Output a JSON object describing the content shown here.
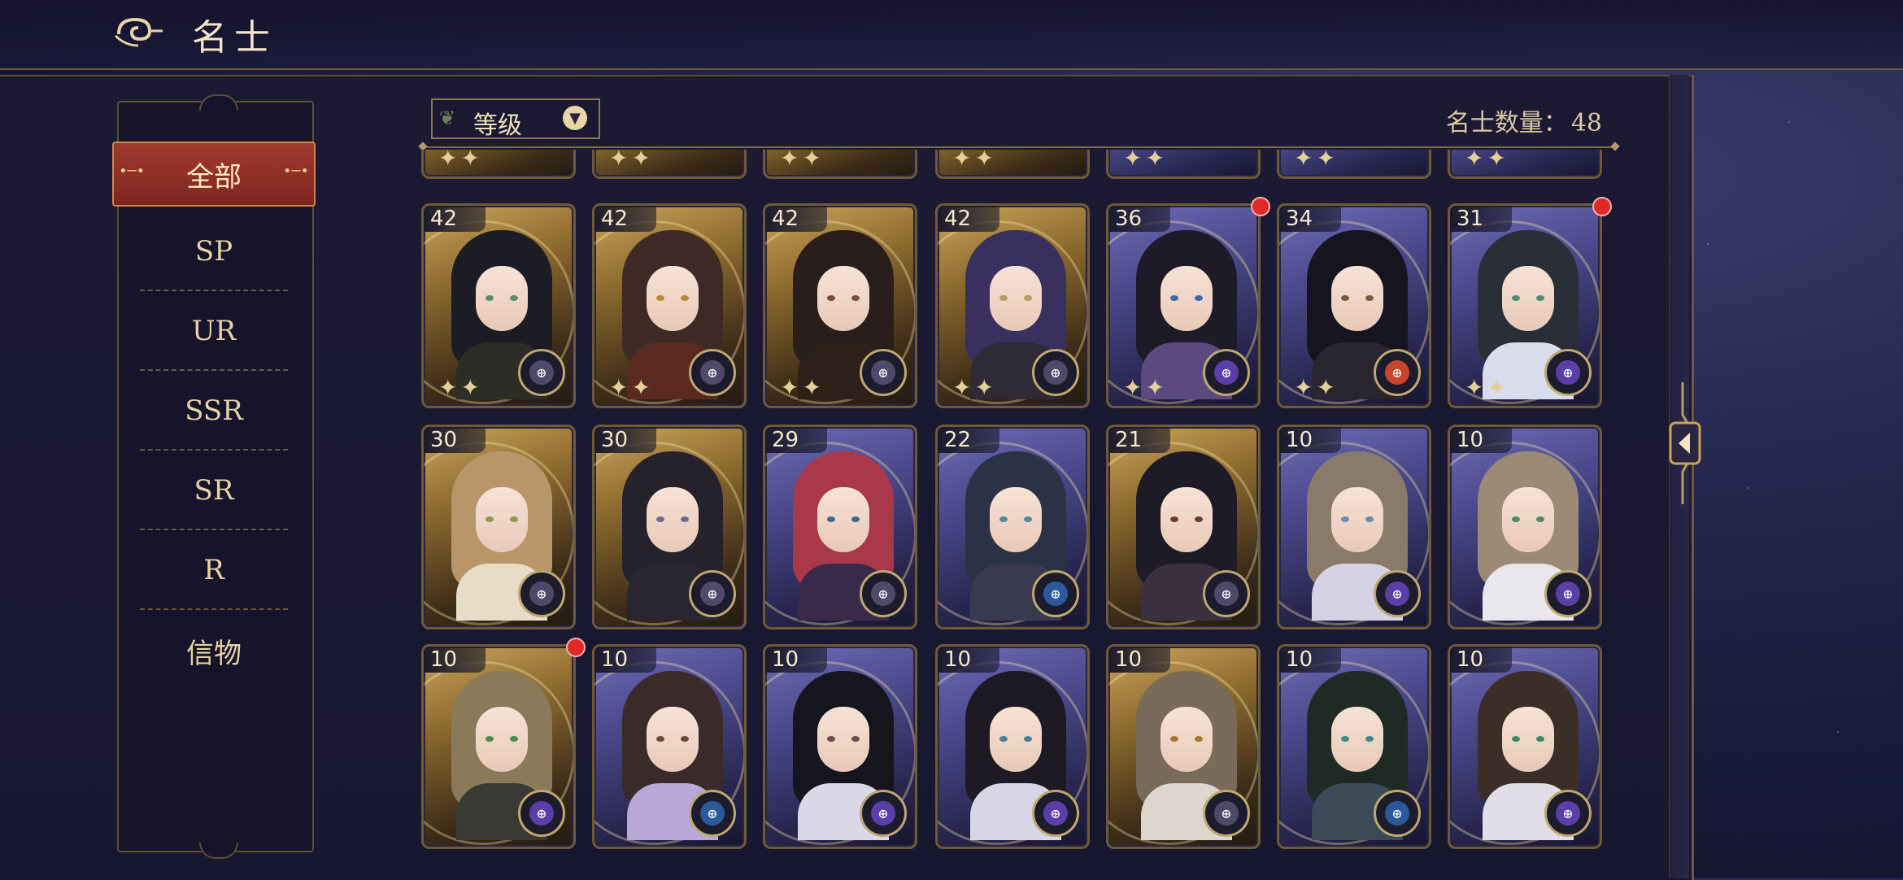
{
  "header": {
    "title": "名士",
    "icon": "cloud-swirl-icon"
  },
  "sidebar": {
    "tabs": [
      {
        "label": "全部",
        "active": true
      },
      {
        "label": "SP"
      },
      {
        "label": "UR"
      },
      {
        "label": "SSR"
      },
      {
        "label": "SR"
      },
      {
        "label": "R"
      },
      {
        "label": "信物"
      }
    ]
  },
  "filter": {
    "label": "等级",
    "icon": "chevron-down-icon"
  },
  "count": {
    "label": "名士数量：",
    "value": "48"
  },
  "colors": {
    "accent_red": "#a33a2e",
    "gold": "#c9a35a",
    "panel": "#1c1a33",
    "notify": "#e02a2a"
  },
  "cards": [
    {
      "level": "42",
      "frame": "gold",
      "hair": "#1c1c24",
      "body": "#2b2d26",
      "eyes": "#5a8c6a",
      "badge": "#4f4a6a",
      "notify": false
    },
    {
      "level": "42",
      "frame": "gold",
      "hair": "#3d2a24",
      "body": "#5a2a20",
      "eyes": "#b58a3a",
      "badge": "#4f4a6a",
      "notify": false
    },
    {
      "level": "42",
      "frame": "gold",
      "hair": "#2a1e1c",
      "body": "#2c2018",
      "eyes": "#7a4a3a",
      "badge": "#4f4a6a",
      "notify": false
    },
    {
      "level": "42",
      "frame": "gold",
      "hair": "#3a3060",
      "body": "#2e2a36",
      "eyes": "#b89a5a",
      "badge": "#4f4a6a",
      "notify": false
    },
    {
      "level": "36",
      "frame": "purple",
      "hair": "#1e1a28",
      "body": "#5a4a80",
      "eyes": "#3a6aa8",
      "badge": "#5a3fa8",
      "notify": true
    },
    {
      "level": "34",
      "frame": "purple",
      "hair": "#16141e",
      "body": "#2a2630",
      "eyes": "#7a5a3a",
      "badge": "#c9442a",
      "notify": false
    },
    {
      "level": "31",
      "frame": "purple",
      "hair": "#2a2e36",
      "body": "#d8dcec",
      "eyes": "#4a8a7a",
      "badge": "#5a3fa8",
      "notify": true
    },
    {
      "level": "30",
      "frame": "gold",
      "hair": "#b8966a",
      "body": "#e6dcc8",
      "eyes": "#8a9a4a",
      "badge": "#4f4a6a",
      "notify": false
    },
    {
      "level": "30",
      "frame": "gold",
      "hair": "#26222c",
      "body": "#2a2630",
      "eyes": "#6a6a9a",
      "badge": "#4f4a6a",
      "notify": false
    },
    {
      "level": "29",
      "frame": "purple",
      "hair": "#a8384a",
      "body": "#3a2a4a",
      "eyes": "#3a6a8a",
      "badge": "#4f4a6a",
      "notify": false
    },
    {
      "level": "22",
      "frame": "purple",
      "hair": "#2c3246",
      "body": "#3a3a4e",
      "eyes": "#4a8a9a",
      "badge": "#2a5a9a",
      "notify": false
    },
    {
      "level": "21",
      "frame": "gold",
      "hair": "#1e1a26",
      "body": "#3a3040",
      "eyes": "#6a3a2a",
      "badge": "#4f4a6a",
      "notify": false
    },
    {
      "level": "10",
      "frame": "purple",
      "hair": "#8a7a6a",
      "body": "#d6d2e6",
      "eyes": "#6a8aa8",
      "badge": "#5a3fa8",
      "notify": false
    },
    {
      "level": "10",
      "frame": "purple",
      "hair": "#9a8a76",
      "body": "#eae6ee",
      "eyes": "#4a8a6a",
      "badge": "#5a3fa8",
      "notify": false
    },
    {
      "level": "10",
      "frame": "gold",
      "hair": "#8a7a5a",
      "body": "#3a3a34",
      "eyes": "#4a8a4a",
      "badge": "#5a3fa8",
      "notify": true
    },
    {
      "level": "10",
      "frame": "purple",
      "hair": "#3a2a2a",
      "body": "#b8a8d8",
      "eyes": "#6a4a3a",
      "badge": "#2a5a9a",
      "notify": false
    },
    {
      "level": "10",
      "frame": "purple",
      "hair": "#16141c",
      "body": "#d8d8e6",
      "eyes": "#6a4a4a",
      "badge": "#5a3fa8",
      "notify": false
    },
    {
      "level": "10",
      "frame": "purple",
      "hair": "#1e1a24",
      "body": "#d6d6e6",
      "eyes": "#4a7a9a",
      "badge": "#5a3fa8",
      "notify": false
    },
    {
      "level": "10",
      "frame": "gold",
      "hair": "#7a6a5a",
      "body": "#dcd6cc",
      "eyes": "#a8762a",
      "badge": "#4f4a6a",
      "notify": false
    },
    {
      "level": "10",
      "frame": "purple",
      "hair": "#1e2a24",
      "body": "#3a4a56",
      "eyes": "#3a8a8a",
      "badge": "#2a5a9a",
      "notify": false
    },
    {
      "level": "10",
      "frame": "purple",
      "hair": "#3a2e26",
      "body": "#e2dee8",
      "eyes": "#3a8a6a",
      "badge": "#5a3fa8",
      "notify": false
    }
  ]
}
